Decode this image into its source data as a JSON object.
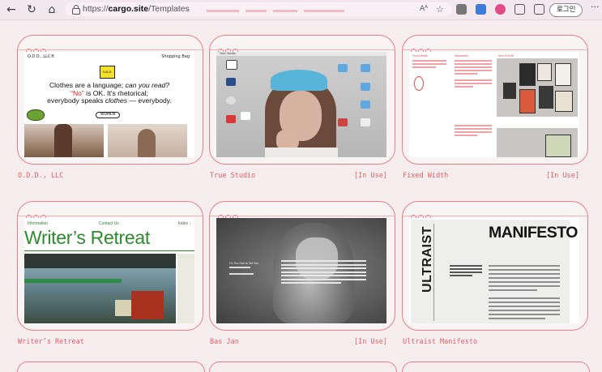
{
  "browser": {
    "url_prefix": "https://",
    "url_domain": "cargo.site",
    "url_path": "/Templates",
    "reader_label": "Aᴬ",
    "login_label": "로그인",
    "more_label": "···"
  },
  "templates": [
    {
      "name": "O.D.D., LLC",
      "status": "",
      "preview": {
        "brand": "O.D.D., LLC®",
        "bag": "Shopping Bag",
        "flag": "O.D.D.",
        "line1": "Clothes are a language; ",
        "line1_em": "can you read?",
        "line2_quote": "“No”",
        "line2_rest": " is OK. It’s rhetorical;",
        "line3": "everybody speaks ",
        "line3_em": "clothes",
        "line3_end": " — everybody.",
        "women": "WOMEN"
      }
    },
    {
      "name": "True Studio",
      "status": "[In Use]",
      "preview": {
        "menubar": "True Studio"
      }
    },
    {
      "name": "Fixed Width",
      "status": "[In Use]",
      "preview": {
        "col1": "Fixed Width",
        "col2": "Newsletter",
        "col3": "Item 8 of 86"
      }
    },
    {
      "name": "Writer’s Retreat",
      "status": "",
      "preview": {
        "nav_left": "Information",
        "nav_mid": "Contact Us",
        "nav_right": "Index ↓",
        "title": "Writer’s Retreat"
      }
    },
    {
      "name": "Bas Jan",
      "status": "[In Use]",
      "preview": {
        "caption": "I'm Too Sad to Tell You"
      }
    },
    {
      "name": "Ultraist Manifesto",
      "status": "",
      "preview": {
        "spine": "ULTRAIST",
        "title": "MANIFESTO"
      }
    }
  ]
}
